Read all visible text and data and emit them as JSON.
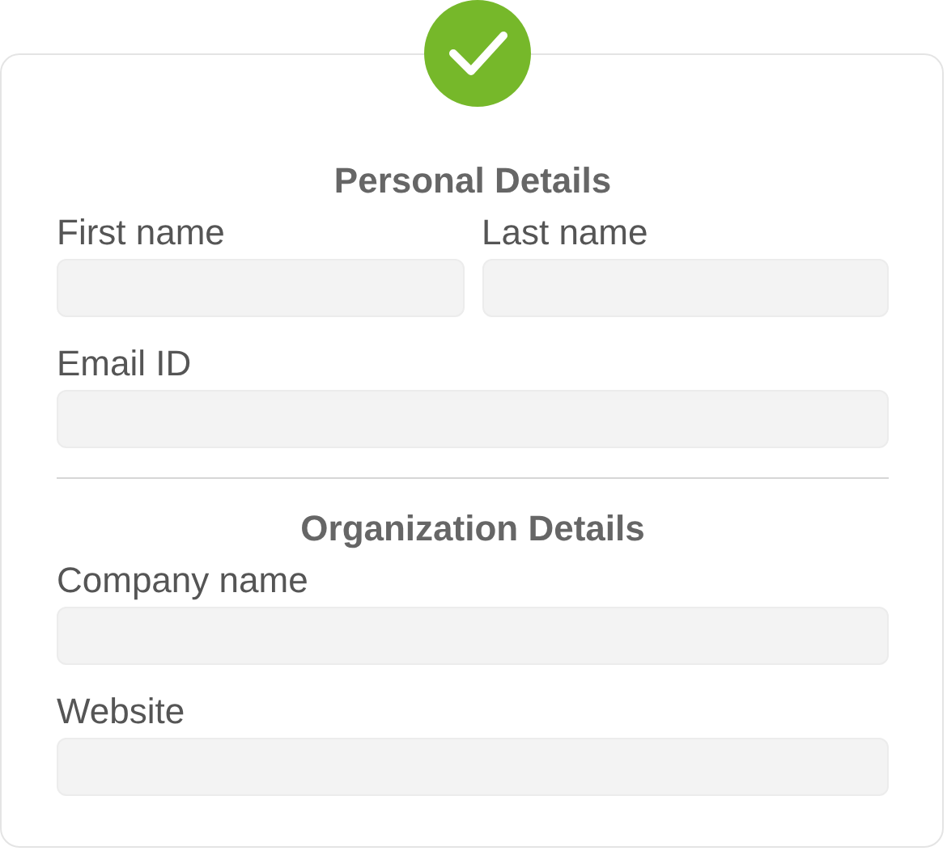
{
  "sections": [
    {
      "title": "Personal Details",
      "rows": [
        [
          {
            "label": "First name"
          },
          {
            "label": "Last name"
          }
        ],
        [
          {
            "label": "Email ID"
          }
        ]
      ]
    },
    {
      "title": "Organization Details",
      "rows": [
        [
          {
            "label": "Company name"
          }
        ],
        [
          {
            "label": "Website"
          }
        ]
      ]
    }
  ]
}
